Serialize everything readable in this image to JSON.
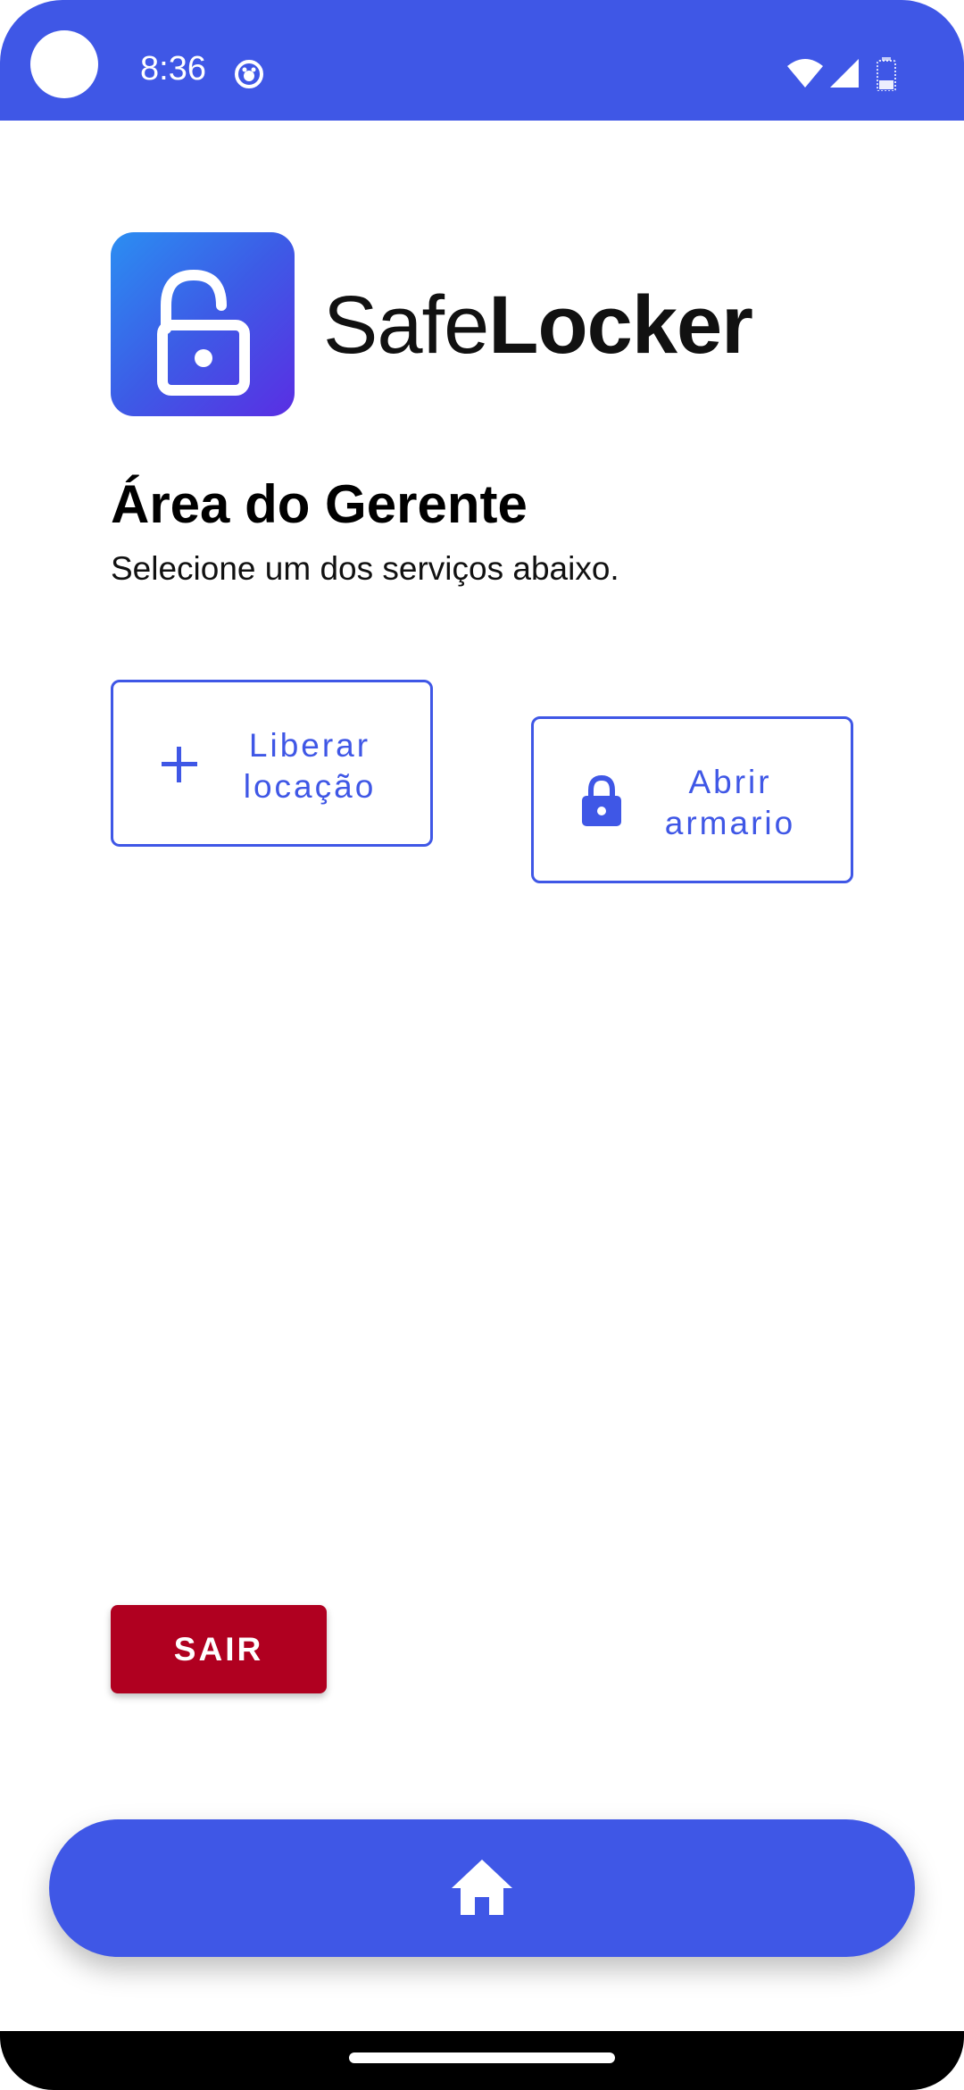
{
  "status_bar": {
    "time": "8:36",
    "background_color": "#3f57e6",
    "icons": [
      "notification-icon",
      "wifi-icon",
      "signal-icon",
      "battery-icon"
    ]
  },
  "logo": {
    "icon": "unlocked-padlock-icon",
    "brand_light": "Safe",
    "brand_bold": "Locker"
  },
  "header": {
    "title": "Área do Gerente",
    "subtitle": "Selecione um dos serviços abaixo."
  },
  "services": [
    {
      "icon": "plus-icon",
      "label_line1": "Liberar",
      "label_line2": "locação"
    },
    {
      "icon": "lock-icon",
      "label_line1": "Abrir",
      "label_line2": "armario"
    }
  ],
  "logout": {
    "label": "SAIR",
    "color": "#b00020"
  },
  "bottom_nav": {
    "icon": "home-icon",
    "color": "#3f57e6"
  },
  "colors": {
    "accent": "#3f57e6",
    "danger": "#b00020"
  }
}
